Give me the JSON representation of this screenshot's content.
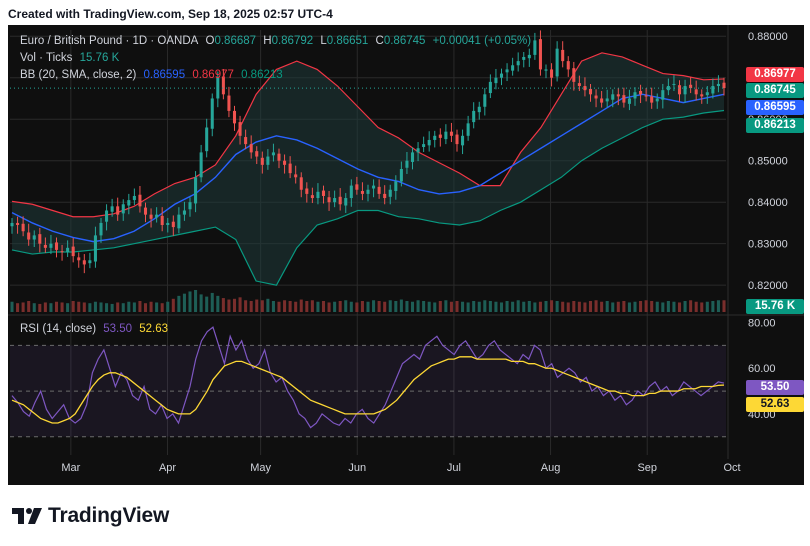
{
  "header": {
    "text": "Created with TradingView.com, Sep 18, 2025 02:57 UTC-4"
  },
  "legend": {
    "symbol": "Euro / British Pound · 1D · OANDA",
    "o_label": "O",
    "o": "0.86687",
    "h_label": "H",
    "h": "0.86792",
    "l_label": "L",
    "l": "0.86651",
    "c_label": "C",
    "c": "0.86745",
    "change": "+0.00041 (+0.05%)",
    "vol_label": "Vol · Ticks",
    "vol": "15.76 K",
    "bb_label": "BB (20, SMA, close, 2)",
    "bb_basis": "0.86595",
    "bb_upper": "0.86977",
    "bb_lower": "0.86213",
    "rsi_label": "RSI (14, close)",
    "rsi": "53.50",
    "rsi_ma": "52.63"
  },
  "tags": {
    "bb_upper": "0.86977",
    "close": "0.86745",
    "bb_basis": "0.86595",
    "bb_lower": "0.86213",
    "vol": "15.76 K",
    "rsi": "53.50",
    "rsi_ma": "52.63"
  },
  "brand": {
    "text": "TradingView"
  },
  "colors": {
    "bg": "#0f0f0f",
    "up": "#26a69a",
    "down": "#ef5350",
    "bb_upper": "#f23645",
    "bb_basis": "#2962ff",
    "bb_lower": "#089981",
    "bb_fill": "#1f3b3b",
    "rsi": "#7e57c2",
    "rsi_ma": "#fdd835",
    "grid": "#2a2a2a"
  },
  "chart_data": [
    {
      "type": "candlestick",
      "title": "Euro / British Pound · 1D · OANDA",
      "x_axis": {
        "tick_labels": [
          "Mar",
          "Apr",
          "May",
          "Jun",
          "Jul",
          "Aug",
          "Sep",
          "Oct"
        ]
      },
      "y_axis": {
        "tick_labels": [
          "0.82000",
          "0.83000",
          "0.84000",
          "0.85000",
          "0.86000",
          "0.87000",
          "0.88000"
        ],
        "ylim": [
          0.8145,
          0.8815
        ]
      },
      "series": [
        {
          "name": "Price (close)",
          "values": [
            0.835,
            0.8345,
            0.833,
            0.831,
            0.832,
            0.83,
            0.829,
            0.83,
            0.8285,
            0.828,
            0.829,
            0.827,
            0.826,
            0.825,
            0.826,
            0.832,
            0.835,
            0.838,
            0.839,
            0.837,
            0.8395,
            0.8405,
            0.8415,
            0.839,
            0.837,
            0.836,
            0.837,
            0.8345,
            0.835,
            0.834,
            0.837,
            0.838,
            0.84,
            0.846,
            0.852,
            0.858,
            0.865,
            0.87,
            0.866,
            0.862,
            0.859,
            0.856,
            0.854,
            0.852,
            0.851,
            0.849,
            0.851,
            0.852,
            0.85,
            0.849,
            0.847,
            0.846,
            0.843,
            0.842,
            0.841,
            0.8425,
            0.8415,
            0.84,
            0.841,
            0.8395,
            0.841,
            0.844,
            0.843,
            0.842,
            0.843,
            0.844,
            0.842,
            0.841,
            0.843,
            0.845,
            0.848,
            0.85,
            0.852,
            0.853,
            0.854,
            0.855,
            0.856,
            0.8555,
            0.857,
            0.856,
            0.854,
            0.856,
            0.859,
            0.862,
            0.863,
            0.866,
            0.869,
            0.87,
            0.871,
            0.872,
            0.873,
            0.874,
            0.875,
            0.8755,
            0.879,
            0.872,
            0.872,
            0.87,
            0.877,
            0.874,
            0.872,
            0.869,
            0.868,
            0.867,
            0.866,
            0.865,
            0.864,
            0.865,
            0.866,
            0.8655,
            0.864,
            0.865,
            0.8665,
            0.866,
            0.8655,
            0.864,
            0.865,
            0.867,
            0.868,
            0.8685,
            0.866,
            0.868,
            0.8675,
            0.866,
            0.8655,
            0.8665,
            0.868,
            0.8685,
            0.8675
          ]
        },
        {
          "name": "BB upper",
          "values": [
            0.8402,
            0.8395,
            0.838,
            0.8365,
            0.8365,
            0.8372,
            0.839,
            0.842,
            0.8445,
            0.846,
            0.849,
            0.856,
            0.866,
            0.872,
            0.874,
            0.872,
            0.868,
            0.863,
            0.858,
            0.8555,
            0.852,
            0.8495,
            0.847,
            0.844,
            0.844,
            0.852,
            0.858,
            0.866,
            0.874,
            0.876,
            0.875,
            0.873,
            0.871,
            0.8705,
            0.8695,
            0.8697
          ]
        },
        {
          "name": "BB basis",
          "values": [
            0.8375,
            0.835,
            0.833,
            0.8315,
            0.8305,
            0.8312,
            0.833,
            0.836,
            0.8395,
            0.842,
            0.846,
            0.8515,
            0.8545,
            0.856,
            0.855,
            0.853,
            0.8505,
            0.848,
            0.846,
            0.845,
            0.843,
            0.842,
            0.8425,
            0.844,
            0.847,
            0.85,
            0.853,
            0.856,
            0.859,
            0.862,
            0.865,
            0.866,
            0.865,
            0.864,
            0.865,
            0.866
          ]
        },
        {
          "name": "BB lower",
          "values": [
            0.8285,
            0.8275,
            0.828,
            0.828,
            0.8285,
            0.829,
            0.83,
            0.831,
            0.832,
            0.833,
            0.834,
            0.831,
            0.821,
            0.82,
            0.829,
            0.8345,
            0.836,
            0.838,
            0.838,
            0.8365,
            0.836,
            0.835,
            0.8345,
            0.8355,
            0.838,
            0.84,
            0.843,
            0.846,
            0.85,
            0.853,
            0.8555,
            0.858,
            0.86,
            0.8605,
            0.8615,
            0.8621
          ]
        }
      ]
    },
    {
      "type": "bar",
      "title": "Vol · Ticks",
      "series": [
        {
          "name": "Vol · Ticks",
          "values": [
            14,
            12,
            13,
            15,
            12,
            11,
            13,
            12,
            14,
            13,
            12,
            15,
            14,
            13,
            12,
            14,
            13,
            12,
            11,
            13,
            12,
            14,
            13,
            15,
            12,
            14,
            13,
            12,
            14,
            18,
            22,
            25,
            28,
            30,
            24,
            21,
            26,
            22,
            19,
            17,
            18,
            20,
            16,
            15,
            17,
            16,
            18,
            15,
            14,
            16,
            15,
            14,
            17,
            15,
            16,
            14,
            15,
            13,
            14,
            15,
            16,
            14,
            13,
            15,
            14,
            16,
            15,
            14,
            16,
            15,
            17,
            15,
            14,
            16,
            15,
            14,
            13,
            15,
            16,
            14,
            15,
            14,
            13,
            15,
            14,
            16,
            15,
            14,
            13,
            15,
            14,
            16,
            14,
            15,
            13,
            14,
            15,
            16,
            15,
            14,
            13,
            15,
            14,
            13,
            15,
            16,
            14,
            15,
            13,
            14,
            15,
            13,
            14,
            15,
            16,
            15,
            14,
            13,
            15,
            14,
            13,
            15,
            16,
            14,
            13,
            14,
            15,
            16,
            16
          ]
        }
      ]
    },
    {
      "type": "line",
      "title": "RSI (14, close)",
      "y_axis": {
        "tick_labels": [
          "40.00",
          "60.00",
          "80.00"
        ],
        "ylim": [
          22,
          82
        ],
        "bands": [
          30,
          50,
          70
        ]
      },
      "series": [
        {
          "name": "RSI",
          "values": [
            48,
            45,
            41,
            39,
            45,
            50,
            42,
            38,
            41,
            44,
            38,
            36,
            38,
            44,
            58,
            64,
            68,
            60,
            52,
            58,
            55,
            48,
            46,
            52,
            42,
            40,
            44,
            38,
            40,
            36,
            44,
            52,
            64,
            72,
            76,
            78,
            70,
            62,
            74,
            68,
            72,
            64,
            60,
            62,
            68,
            58,
            54,
            56,
            50,
            46,
            40,
            38,
            34,
            36,
            40,
            38,
            36,
            35,
            38,
            36,
            40,
            42,
            38,
            36,
            40,
            44,
            50,
            56,
            62,
            64,
            66,
            64,
            70,
            72,
            74,
            70,
            68,
            66,
            70,
            72,
            68,
            64,
            66,
            70,
            72,
            68,
            66,
            64,
            62,
            66,
            64,
            70,
            68,
            60,
            62,
            56,
            58,
            60,
            58,
            54,
            56,
            50,
            52,
            48,
            50,
            46,
            48,
            44,
            46,
            50,
            48,
            52,
            54,
            50,
            52,
            48,
            50,
            54,
            52,
            50,
            48,
            50,
            52,
            54,
            53.5
          ]
        },
        {
          "name": "RSI-based MA",
          "values": [
            46,
            45,
            44,
            42,
            40,
            38,
            37,
            36,
            36,
            37,
            38,
            40,
            44,
            48,
            52,
            55,
            57,
            58,
            58,
            57,
            56,
            54,
            52,
            50,
            48,
            46,
            44,
            42,
            41,
            40,
            40,
            40,
            42,
            46,
            50,
            55,
            58,
            61,
            62,
            63,
            63,
            62,
            61,
            60,
            59,
            58,
            57,
            56,
            54,
            52,
            50,
            48,
            46,
            45,
            44,
            43,
            42,
            41,
            40,
            40,
            40,
            40,
            40,
            40,
            41,
            42,
            44,
            46,
            49,
            52,
            55,
            57,
            59,
            61,
            62,
            63,
            64,
            64,
            65,
            65,
            65,
            64,
            64,
            64,
            64,
            64,
            64,
            63,
            63,
            63,
            62,
            62,
            61,
            60,
            60,
            59,
            58,
            57,
            56,
            55,
            54,
            53,
            52,
            51,
            50,
            50,
            49,
            49,
            48,
            48,
            48,
            49,
            49,
            50,
            50,
            50,
            50,
            51,
            51,
            51,
            52,
            52,
            52,
            52.5,
            52.63
          ]
        }
      ]
    }
  ]
}
